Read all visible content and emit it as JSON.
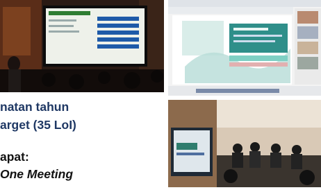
{
  "text_lines": [
    "natan tahun",
    "arget (35 LoI)",
    "apat:",
    "One Meeting"
  ],
  "colors": {
    "heading": "#1f3864",
    "body_text": "#111111",
    "background": "#ffffff"
  },
  "photos": [
    "presentation-hall-photo",
    "screen-share-meeting-screenshot",
    "meeting-room-photo"
  ]
}
